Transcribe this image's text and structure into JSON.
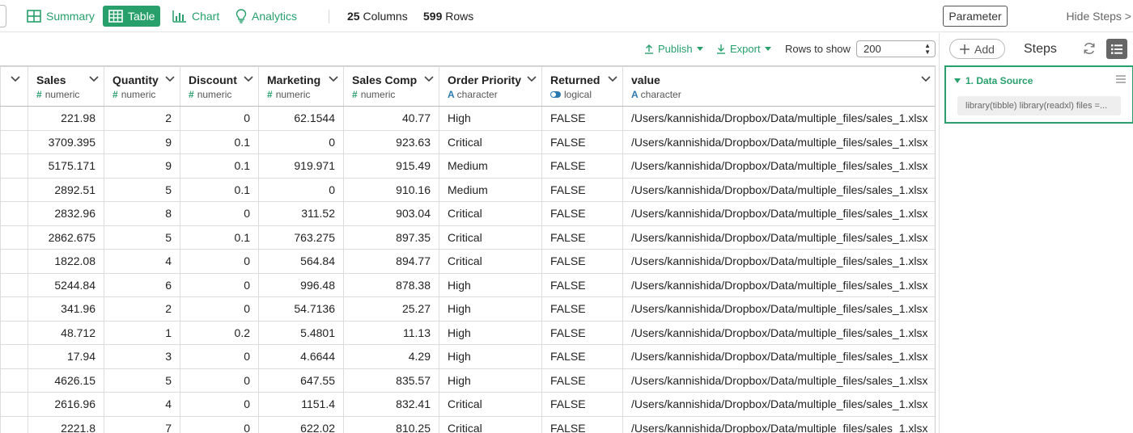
{
  "view_tabs": [
    {
      "label": "Summary",
      "active": false
    },
    {
      "label": "Table",
      "active": true
    },
    {
      "label": "Chart",
      "active": false
    },
    {
      "label": "Analytics",
      "active": false
    }
  ],
  "stats": {
    "columns_count": "25",
    "columns_label": "Columns",
    "rows_count": "599",
    "rows_label": "Rows"
  },
  "header_right": {
    "parameter_label": "Parameter",
    "hide_steps_label": "Hide Steps >"
  },
  "toolbar": {
    "publish_label": "Publish",
    "export_label": "Export",
    "rows_to_show_label": "Rows to show",
    "rows_to_show_value": "200"
  },
  "table": {
    "columns": [
      {
        "name": "Sales",
        "type": "numeric"
      },
      {
        "name": "Quantity",
        "type": "numeric"
      },
      {
        "name": "Discount",
        "type": "numeric"
      },
      {
        "name": "Marketing",
        "type": "numeric"
      },
      {
        "name": "Sales Comp",
        "type": "numeric"
      },
      {
        "name": "Order Priority",
        "type": "character"
      },
      {
        "name": "Returned",
        "type": "logical"
      },
      {
        "name": "value",
        "type": "character"
      }
    ],
    "rows": [
      [
        "221.98",
        "2",
        "0",
        "62.1544",
        "40.77",
        "High",
        "FALSE",
        "/Users/kannishida/Dropbox/Data/multiple_files/sales_1.xlsx"
      ],
      [
        "3709.395",
        "9",
        "0.1",
        "0",
        "923.63",
        "Critical",
        "FALSE",
        "/Users/kannishida/Dropbox/Data/multiple_files/sales_1.xlsx"
      ],
      [
        "5175.171",
        "9",
        "0.1",
        "919.971",
        "915.49",
        "Medium",
        "FALSE",
        "/Users/kannishida/Dropbox/Data/multiple_files/sales_1.xlsx"
      ],
      [
        "2892.51",
        "5",
        "0.1",
        "0",
        "910.16",
        "Medium",
        "FALSE",
        "/Users/kannishida/Dropbox/Data/multiple_files/sales_1.xlsx"
      ],
      [
        "2832.96",
        "8",
        "0",
        "311.52",
        "903.04",
        "Critical",
        "FALSE",
        "/Users/kannishida/Dropbox/Data/multiple_files/sales_1.xlsx"
      ],
      [
        "2862.675",
        "5",
        "0.1",
        "763.275",
        "897.35",
        "Critical",
        "FALSE",
        "/Users/kannishida/Dropbox/Data/multiple_files/sales_1.xlsx"
      ],
      [
        "1822.08",
        "4",
        "0",
        "564.84",
        "894.77",
        "Critical",
        "FALSE",
        "/Users/kannishida/Dropbox/Data/multiple_files/sales_1.xlsx"
      ],
      [
        "5244.84",
        "6",
        "0",
        "996.48",
        "878.38",
        "High",
        "FALSE",
        "/Users/kannishida/Dropbox/Data/multiple_files/sales_1.xlsx"
      ],
      [
        "341.96",
        "2",
        "0",
        "54.7136",
        "25.27",
        "High",
        "FALSE",
        "/Users/kannishida/Dropbox/Data/multiple_files/sales_1.xlsx"
      ],
      [
        "48.712",
        "1",
        "0.2",
        "5.4801",
        "11.13",
        "High",
        "FALSE",
        "/Users/kannishida/Dropbox/Data/multiple_files/sales_1.xlsx"
      ],
      [
        "17.94",
        "3",
        "0",
        "4.6644",
        "4.29",
        "High",
        "FALSE",
        "/Users/kannishida/Dropbox/Data/multiple_files/sales_1.xlsx"
      ],
      [
        "4626.15",
        "5",
        "0",
        "647.55",
        "835.57",
        "High",
        "FALSE",
        "/Users/kannishida/Dropbox/Data/multiple_files/sales_1.xlsx"
      ],
      [
        "2616.96",
        "4",
        "0",
        "1151.4",
        "832.41",
        "Critical",
        "FALSE",
        "/Users/kannishida/Dropbox/Data/multiple_files/sales_1.xlsx"
      ],
      [
        "2221.8",
        "7",
        "0",
        "622.02",
        "810.25",
        "Critical",
        "FALSE",
        "/Users/kannishida/Dropbox/Data/multiple_files/sales_1.xlsx"
      ]
    ]
  },
  "steps_panel": {
    "add_label": "Add",
    "title": "Steps",
    "steps": [
      {
        "title": "1. Data Source",
        "code": "library(tibble) library(readxl) files =..."
      }
    ]
  },
  "colors": {
    "accent": "#27a06b",
    "type_blue": "#2a7ab0"
  }
}
